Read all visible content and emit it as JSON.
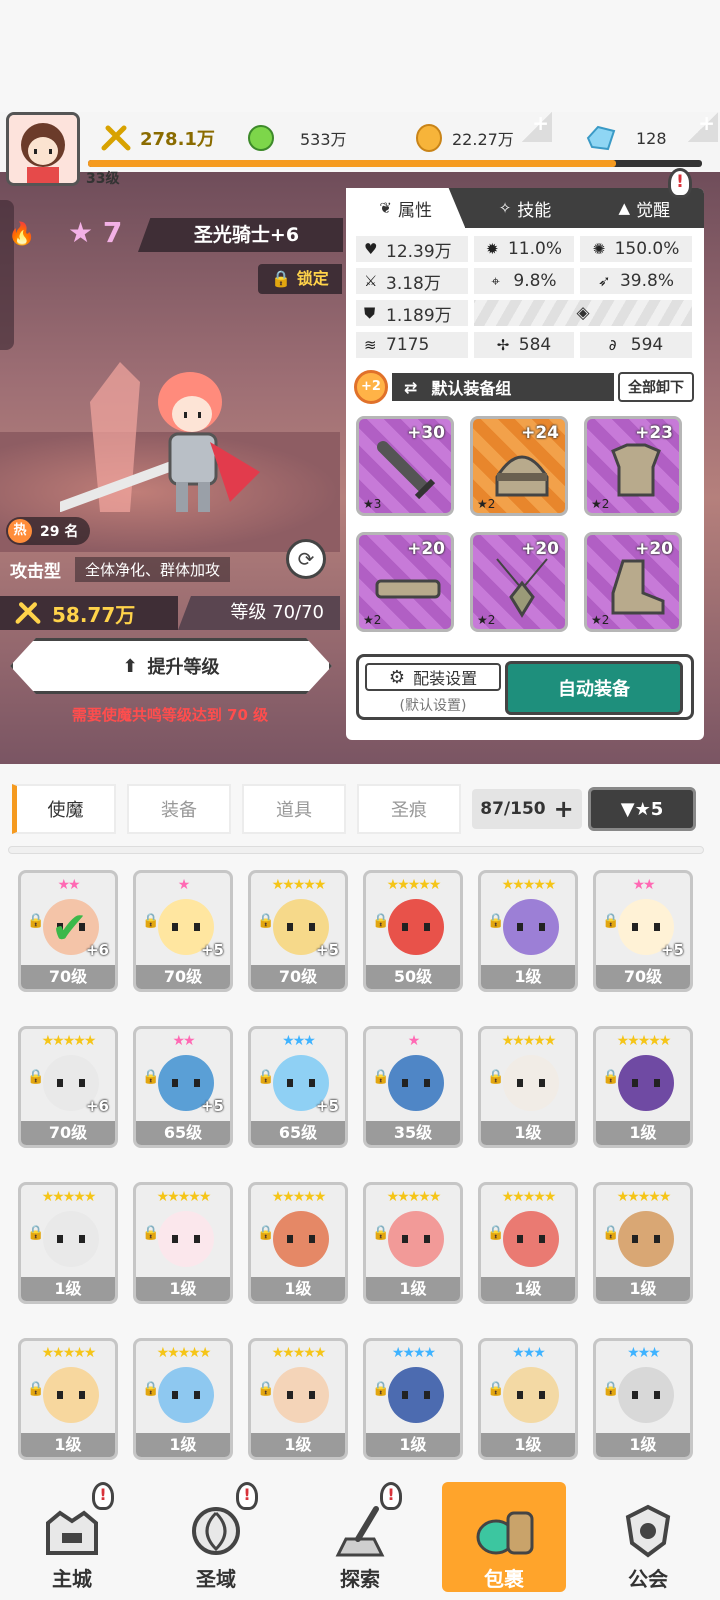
{
  "player": {
    "level": "33级",
    "power": "278.1万",
    "green_gem": "533万",
    "gold": "22.27万",
    "diamond": "128",
    "xp_fraction": 0.86
  },
  "hero": {
    "stars": "7",
    "name": "圣光骑士+6",
    "lock_label": "锁定",
    "hot_label": "热",
    "hot_rank": "29 名",
    "type": "攻击型",
    "desc": "全体净化、群体加攻",
    "power": "58.77万",
    "level_text": "等级 70/70",
    "levelup_label": "提升等级",
    "levelup_note": "需要使魔共鸣等级达到 70 级"
  },
  "panel": {
    "tabs": [
      {
        "label": "属性",
        "icon": "attribute-icon"
      },
      {
        "label": "技能",
        "icon": "skill-icon"
      },
      {
        "label": "觉醒",
        "icon": "awaken-icon"
      }
    ],
    "alert": "!",
    "stats": {
      "hp": "12.39万",
      "crit": "11.0%",
      "crit_dmg": "150.0%",
      "atk": "3.18万",
      "hit": "9.8%",
      "dodge": "39.8%",
      "def": "1.189万",
      "speed": "7175",
      "res": "584",
      "tenacity": "594"
    },
    "equip_bonus": "+2",
    "equip_group": "默认装备组",
    "unequip_label": "全部卸下",
    "equipment": [
      {
        "name": "sword",
        "plus": "+30",
        "star": "★3",
        "color": "purple"
      },
      {
        "name": "helmet",
        "plus": "+24",
        "star": "★2",
        "color": "orange"
      },
      {
        "name": "armor",
        "plus": "+23",
        "star": "★2",
        "color": "purple"
      },
      {
        "name": "belt",
        "plus": "+20",
        "star": "★2",
        "color": "purple"
      },
      {
        "name": "necklace",
        "plus": "+20",
        "star": "★2",
        "color": "purple"
      },
      {
        "name": "boots",
        "plus": "+20",
        "star": "★2",
        "color": "purple"
      }
    ],
    "loadout_label": "配装设置",
    "loadout_sub": "(默认设置)",
    "auto_equip_label": "自动装备"
  },
  "filters": {
    "tabs": [
      "使魔",
      "装备",
      "道具",
      "圣痕"
    ],
    "count": "87/150",
    "count_plus": "+",
    "star_filter": "▼★5"
  },
  "heroes": [
    {
      "stars": "★★",
      "star_color": "pink",
      "level": "70级",
      "plus": "+6",
      "face": "#f4c4a8",
      "check": true
    },
    {
      "stars": "★",
      "star_color": "pink",
      "level": "70级",
      "plus": "+5",
      "face": "#ffe6a0"
    },
    {
      "stars": "★★★★★",
      "star_color": "gold",
      "level": "70级",
      "plus": "+5",
      "face": "#f6d98a"
    },
    {
      "stars": "★★★★★",
      "star_color": "gold",
      "level": "50级",
      "plus": "",
      "face": "#e8524a"
    },
    {
      "stars": "★★★★★",
      "star_color": "gold",
      "level": "1级",
      "plus": "",
      "face": "#9c7fd6"
    },
    {
      "stars": "★★",
      "star_color": "pink",
      "level": "70级",
      "plus": "+5",
      "face": "#fff2d6"
    },
    {
      "stars": "★★★★★",
      "star_color": "gold",
      "level": "70级",
      "plus": "+6",
      "face": "#e9e9e9"
    },
    {
      "stars": "★★",
      "star_color": "pink",
      "level": "65级",
      "plus": "+5",
      "face": "#5a9fd6"
    },
    {
      "stars": "★★★",
      "star_color": "blue",
      "level": "65级",
      "plus": "+5",
      "face": "#8fd0f4"
    },
    {
      "stars": "★",
      "star_color": "pink",
      "level": "35级",
      "plus": "",
      "face": "#4f86c6"
    },
    {
      "stars": "★★★★★",
      "star_color": "gold",
      "level": "1级",
      "plus": "",
      "face": "#f1ece6"
    },
    {
      "stars": "★★★★★",
      "star_color": "gold",
      "level": "1级",
      "plus": "",
      "face": "#6f4aa3"
    },
    {
      "stars": "★★★★★",
      "star_color": "gold",
      "level": "1级",
      "plus": "",
      "face": "#e9e9e9"
    },
    {
      "stars": "★★★★★",
      "star_color": "gold",
      "level": "1级",
      "plus": "",
      "face": "#fbe7ec"
    },
    {
      "stars": "★★★★★",
      "star_color": "gold",
      "level": "1级",
      "plus": "",
      "face": "#e58866"
    },
    {
      "stars": "★★★★★",
      "star_color": "gold",
      "level": "1级",
      "plus": "",
      "face": "#f29a98"
    },
    {
      "stars": "★★★★★",
      "star_color": "gold",
      "level": "1级",
      "plus": "",
      "face": "#ea7a72"
    },
    {
      "stars": "★★★★★",
      "star_color": "gold",
      "level": "1级",
      "plus": "",
      "face": "#d9a774"
    },
    {
      "stars": "★★★★★",
      "star_color": "gold",
      "level": "1级",
      "plus": "",
      "face": "#f7d79e"
    },
    {
      "stars": "★★★★★",
      "star_color": "gold",
      "level": "1级",
      "plus": "",
      "face": "#8ec8f0"
    },
    {
      "stars": "★★★★★",
      "star_color": "gold",
      "level": "1级",
      "plus": "",
      "face": "#f4d4b8"
    },
    {
      "stars": "★★★★",
      "star_color": "blue",
      "level": "1级",
      "plus": "",
      "face": "#4c6bb0"
    },
    {
      "stars": "★★★",
      "star_color": "blue",
      "level": "1级",
      "plus": "",
      "face": "#f3d9a4"
    },
    {
      "stars": "★★★",
      "star_color": "blue",
      "level": "1级",
      "plus": "",
      "face": "#d8d8d8"
    },
    {
      "stars": "★★★",
      "star_color": "blue",
      "level": "",
      "plus": "",
      "face": "#f4e6da"
    },
    {
      "stars": "★★★",
      "star_color": "blue",
      "level": "",
      "plus": "",
      "face": "#ece8de"
    },
    {
      "stars": "★★★",
      "star_color": "blue",
      "level": "",
      "plus": "",
      "face": "#f0d4a4"
    },
    {
      "stars": "★★★",
      "star_color": "blue",
      "level": "",
      "plus": "",
      "face": "#6e6e6e"
    },
    {
      "stars": "★★★",
      "star_color": "blue",
      "level": "",
      "plus": "",
      "face": "#f1ede4"
    },
    {
      "stars": "★★★",
      "star_color": "blue",
      "level": "",
      "plus": "",
      "face": "#7d4dbd"
    }
  ],
  "nav": [
    {
      "label": "主城",
      "icon": "castle-icon",
      "alert": "!",
      "active": false
    },
    {
      "label": "圣域",
      "icon": "portal-icon",
      "alert": "!",
      "active": false
    },
    {
      "label": "探索",
      "icon": "sword-stone-icon",
      "alert": "!",
      "active": false
    },
    {
      "label": "包裹",
      "icon": "bag-icon",
      "alert": "",
      "active": true
    },
    {
      "label": "公会",
      "icon": "guild-icon",
      "alert": "",
      "active": false
    }
  ]
}
